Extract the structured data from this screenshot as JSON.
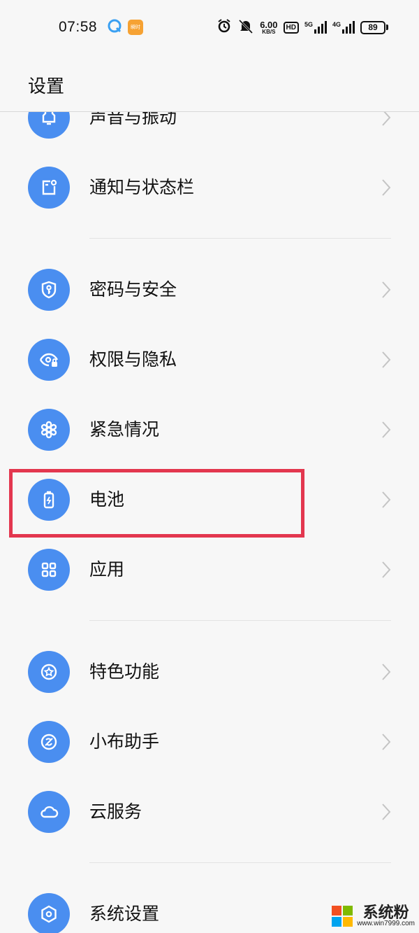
{
  "status_bar": {
    "time": "07:58",
    "app_badge_text": "瞬时",
    "net_speed_value": "6.00",
    "net_speed_unit": "KB/S",
    "hd_label": "HD",
    "net1_label": "5G",
    "net2_label": "4G",
    "battery_level": "89",
    "icons": [
      "browser-icon",
      "app-badge-icon",
      "alarm-icon",
      "mute-icon",
      "signal-icon",
      "battery-icon"
    ]
  },
  "header": {
    "title": "设置"
  },
  "settings_items": [
    {
      "label": "声音与振动",
      "icon": "speaker-icon"
    },
    {
      "label": "通知与状态栏",
      "icon": "notification-icon"
    },
    {
      "label": "密码与安全",
      "icon": "shield-key-icon"
    },
    {
      "label": "权限与隐私",
      "icon": "eye-lock-icon"
    },
    {
      "label": "紧急情况",
      "icon": "asterisk-icon"
    },
    {
      "label": "电池",
      "icon": "battery-icon"
    },
    {
      "label": "应用",
      "icon": "grid-icon"
    },
    {
      "label": "特色功能",
      "icon": "star-icon"
    },
    {
      "label": "小布助手",
      "icon": "assistant-icon"
    },
    {
      "label": "云服务",
      "icon": "cloud-icon"
    },
    {
      "label": "系统设置",
      "icon": "hexagon-gear-icon"
    }
  ],
  "highlight_target": "电池",
  "watermark": {
    "text": "系统粉",
    "url": "www.win7999.com"
  },
  "colors": {
    "icon_bg": "#4a8ef0",
    "highlight_border": "#e3374f",
    "page_bg": "#f7f7f7"
  }
}
